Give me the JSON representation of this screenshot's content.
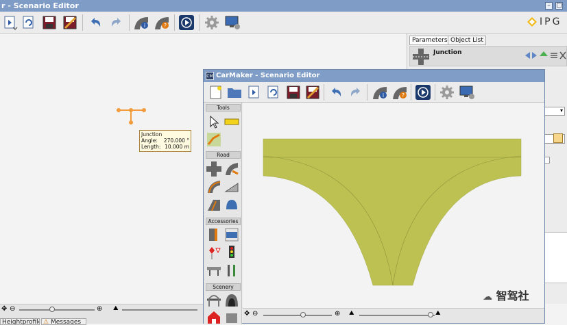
{
  "back_window": {
    "title": "r - Scenario Editor",
    "brand": "IPG",
    "tabs": {
      "parameters": "Parameters",
      "object_list": "Object List"
    },
    "object_name": "Junction",
    "bottom_tabs": [
      "Heightprofile",
      "Messages"
    ]
  },
  "tooltip": {
    "title": "Junction",
    "angle_label": "Angle:",
    "angle_value": "270.000 °",
    "length_label": "Length:",
    "length_value": "10.000 m"
  },
  "front_window": {
    "title": "CarMaker - Scenario Editor",
    "title_icon": "CM",
    "groups": {
      "tools": "Tools",
      "road": "Road",
      "accessories": "Accessories",
      "scenery": "Scenery"
    }
  },
  "watermark": {
    "text": "智驾社"
  },
  "colors": {
    "road_fill": "#bcc152",
    "junction_marker": "#f29b3c",
    "titlebar": "#7f9dc6"
  }
}
